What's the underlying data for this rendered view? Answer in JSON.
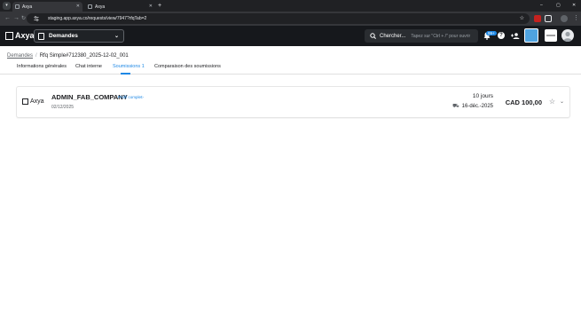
{
  "browser": {
    "tabs": [
      {
        "title": "Axya",
        "active": true
      },
      {
        "title": "Axya",
        "active": false
      }
    ],
    "new_tab_label": "+",
    "url": "staging.app.axya.co/requests/view/7947?rfqTab=2",
    "window_controls": {
      "minimize": "–",
      "maximize": "▢",
      "close": "✕"
    }
  },
  "app": {
    "logo_text": "Axya",
    "module_label": "Demandes",
    "search": {
      "label": "Chercher...",
      "hint": "Tapez sur \"Ctrl + /\" pour ouvrir"
    },
    "notifications_badge": "99+"
  },
  "breadcrumb": {
    "root": "Demandes",
    "separator": "/",
    "current": "Rfq Simple#712380_2025-12-02_001"
  },
  "page_tabs": [
    {
      "label": "Informations générales",
      "active": false
    },
    {
      "label": "Chat interne",
      "active": false
    },
    {
      "label": "Soumissions 1",
      "active": true
    },
    {
      "label": "Comparaison des soumissions",
      "active": false
    }
  ],
  "submission": {
    "company_logo_text": "Axya",
    "company": "ADMIN_FAB_COMPANY",
    "profile_link": "Profil complet",
    "date": "02/12/2025",
    "duration": "10 jours",
    "delivery_date": "16-déc.-2025",
    "price": "CAD 100,00"
  },
  "colors": {
    "accent": "#1e88e5",
    "app_header": "#16181c",
    "browser_chrome": "#202124"
  }
}
